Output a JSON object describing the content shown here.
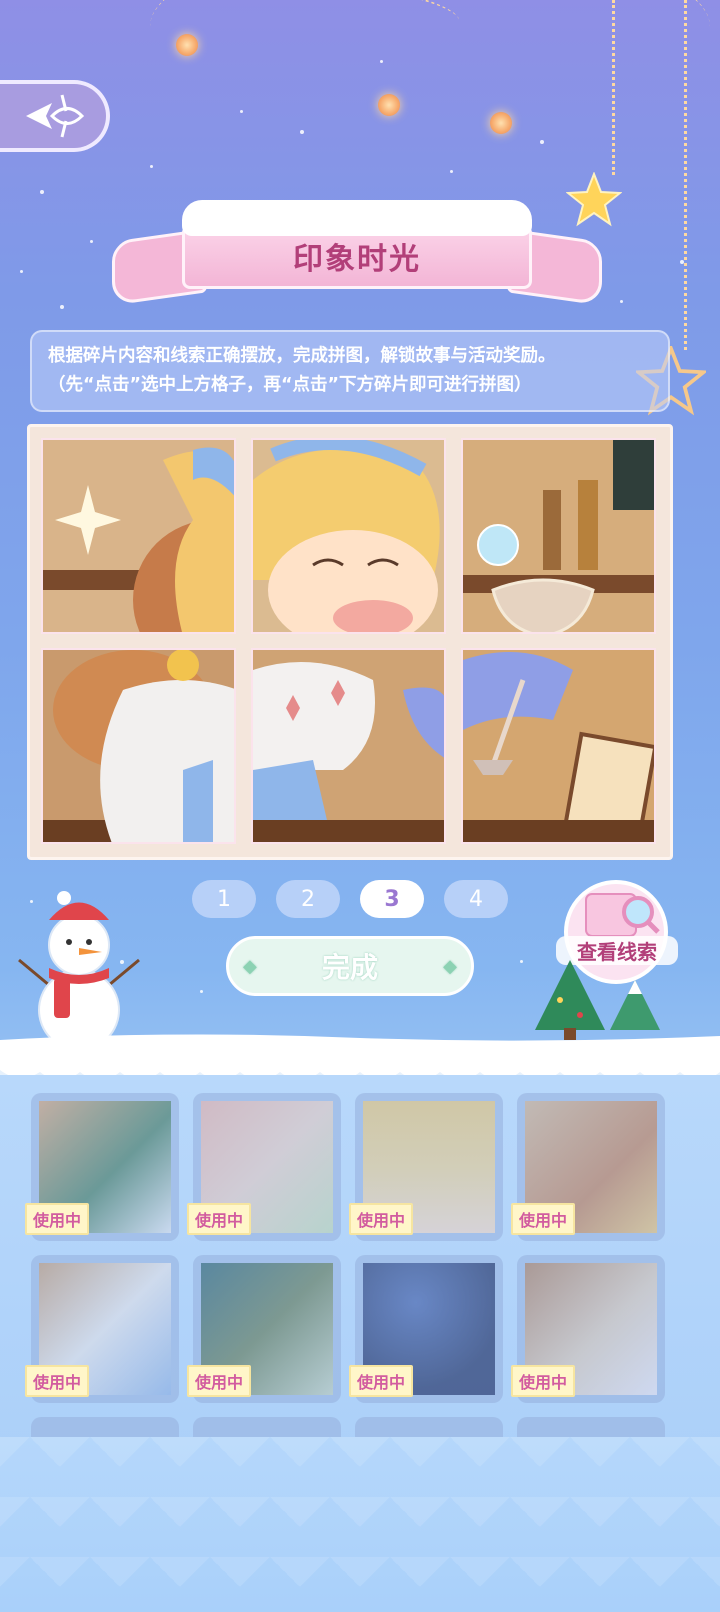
{
  "header": {
    "back_icon": "back-arrow-icon",
    "title": "印象时光"
  },
  "instructions": {
    "line1": "根据碎片内容和线索正确摆放，完成拼图，解锁故事与活动奖励。",
    "line2": "（先“点击”选中上方格子，再“点击”下方碎片即可进行拼图）"
  },
  "pager": {
    "pages": [
      "1",
      "2",
      "3",
      "4"
    ],
    "active": "3"
  },
  "actions": {
    "done_label": "完成",
    "clue_label": "查看线索"
  },
  "pieces": {
    "status_label": "使用中",
    "items": [
      {
        "label": "使用中",
        "scene": "christmas-tree"
      },
      {
        "label": "使用中",
        "scene": "gift-boxes"
      },
      {
        "label": "使用中",
        "scene": "girl-face"
      },
      {
        "label": "使用中",
        "scene": "girl-sparkle"
      },
      {
        "label": "使用中",
        "scene": "girl-arm"
      },
      {
        "label": "使用中",
        "scene": "green-bag"
      },
      {
        "label": "使用中",
        "scene": "night-sky"
      },
      {
        "label": "使用中",
        "scene": "town-street"
      }
    ]
  },
  "colors": {
    "title_text": "#b23f79",
    "badge_text": "#d25c9f",
    "active_page_text": "#9a77d1"
  }
}
